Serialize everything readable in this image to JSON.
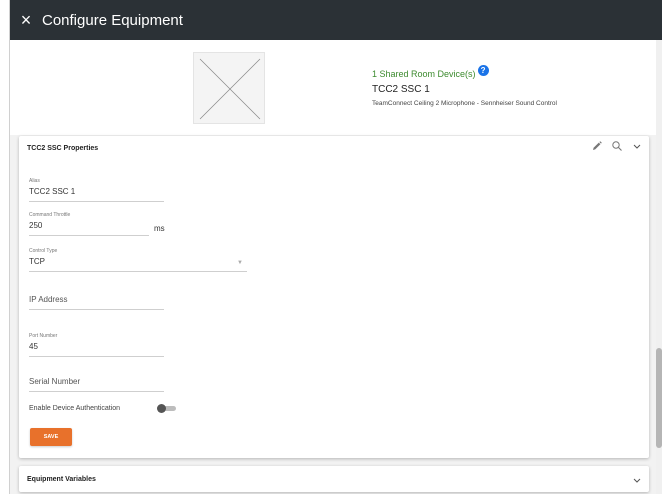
{
  "window": {
    "title": "Configure Equipment",
    "close_glyph": "×"
  },
  "device": {
    "shared_count": "1 Shared Room Device(s)",
    "help_glyph": "?",
    "name": "TCC2 SSC 1",
    "description": "TeamConnect Ceiling 2 Microphone - Sennheiser Sound Control"
  },
  "properties": {
    "title": "TCC2 SSC Properties",
    "alias": {
      "label": "Alias",
      "value": "TCC2 SSC 1"
    },
    "command_throttle": {
      "label": "Command Throttle",
      "value": "250",
      "unit": "ms"
    },
    "control_type": {
      "label": "Control Type",
      "value": "TCP"
    },
    "ip_address": {
      "placeholder": "IP Address",
      "value": ""
    },
    "port_number": {
      "label": "Port Number",
      "value": "45"
    },
    "serial_number": {
      "placeholder": "Serial Number",
      "value": ""
    },
    "enable_auth": {
      "label": "Enable Device Authentication",
      "enabled": false
    },
    "save_label": "SAVE"
  },
  "equipment_variables": {
    "title": "Equipment Variables"
  },
  "icons": {
    "edit": "pencil-icon",
    "search": "search-icon",
    "collapse": "chevron-down-icon",
    "close": "close-icon"
  },
  "colors": {
    "topbar": "#2b3136",
    "accent": "#e8712b",
    "shared_text": "#3d8b2f",
    "help": "#1a73e8"
  }
}
